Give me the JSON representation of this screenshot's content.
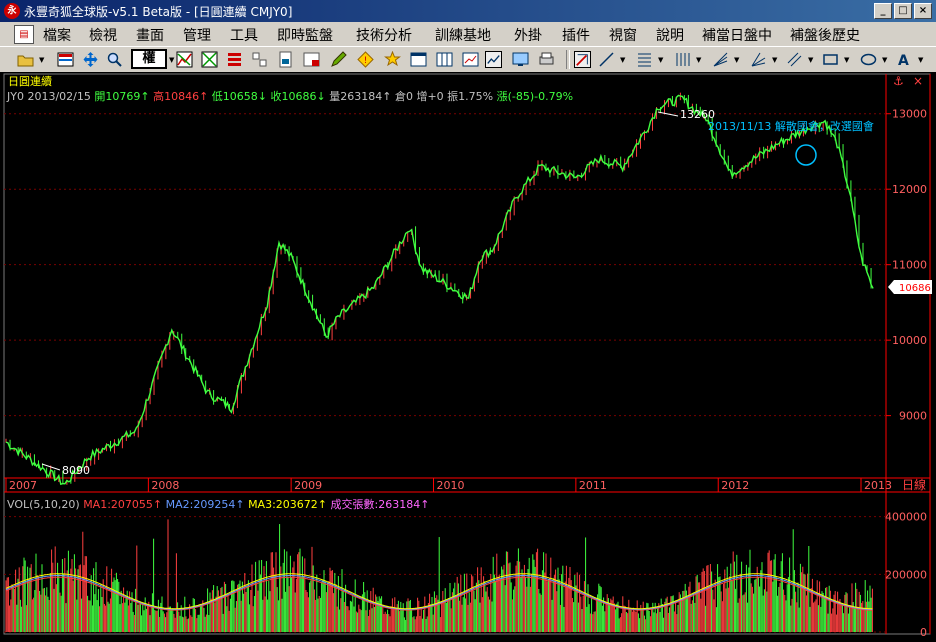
{
  "window": {
    "title": "永豐奇狐全球版-v5.1 Beta版 - [日圓連續 CMJY0]",
    "app_icon": "fox-logo-icon",
    "buttons": [
      "_",
      "□",
      "×"
    ]
  },
  "menu": {
    "items": [
      "檔案",
      "檢視",
      "畫面",
      "管理",
      "工具",
      "即時監盤",
      "技術分析",
      "訓練基地",
      "外掛",
      "插件",
      "視窗",
      "說明",
      "補當日盤中",
      "補盤後歷史"
    ]
  },
  "toolbar": {
    "quan_label": "權"
  },
  "chart": {
    "panel_title": "日圓連續",
    "info": {
      "symbol_date": "JY0 2013/02/15",
      "open": "開10769↑",
      "high": "高10846↑",
      "low": "低10658↓",
      "close": "收10686↓",
      "volume": "量263184↑",
      "oi": "倉0",
      "oi_change": "增+0",
      "amplitude": "振1.75%",
      "change": "漲(-85)-0.79%"
    },
    "annotation": "2013/11/13 解散國會，改選國會",
    "high_label": "13260",
    "low_label": "8090",
    "current_price_label": "10686",
    "x_axis_unit": "日線",
    "colors": {
      "up": "#ff4040",
      "down": "#40ff40",
      "grid": "#7a0000",
      "axis": "#ff0000",
      "annotation": "#00c0ff"
    }
  },
  "volume": {
    "labels": {
      "title": "VOL(5,10,20)",
      "ma1": "MA1:207055↑",
      "ma2": "MA2:209254↑",
      "ma3": "MA3:203672↑",
      "total": "成交張數:263184↑"
    }
  },
  "chart_data": [
    {
      "type": "line",
      "title": "日圓連續",
      "x": [
        "2007-01",
        "2007-06",
        "2007-08",
        "2007-12",
        "2008-03",
        "2008-06",
        "2008-08",
        "2008-11",
        "2008-12",
        "2009-01",
        "2009-04",
        "2009-05",
        "2009-08",
        "2009-11",
        "2009-12",
        "2010-04",
        "2010-05",
        "2010-06",
        "2010-08",
        "2010-10",
        "2011-01",
        "2011-03",
        "2011-05",
        "2011-07",
        "2011-08",
        "2011-10",
        "2011-11",
        "2011-12",
        "2012-02",
        "2012-04",
        "2012-06",
        "2012-09",
        "2012-10",
        "2012-11",
        "2012-12",
        "2013-01",
        "2013-02"
      ],
      "series": [
        {
          "values": [
            8650,
            8090,
            8450,
            8800,
            10150,
            9300,
            9100,
            10500,
            11300,
            11100,
            10050,
            10300,
            10700,
            11500,
            10950,
            10550,
            11100,
            11200,
            11900,
            12300,
            12150,
            12400,
            12300,
            12800,
            13100,
            13200,
            13050,
            12950,
            12200,
            12400,
            12600,
            12850,
            12900,
            12600,
            12000,
            11100,
            10686
          ]
        }
      ],
      "ylim": [
        8200,
        13500
      ],
      "y_ticks": [
        9000,
        10000,
        11000,
        12000,
        13000
      ],
      "x_tick_labels": [
        "2007",
        "2008",
        "2009",
        "2010",
        "2011",
        "2012",
        "2013"
      ],
      "xlabel": "日線",
      "grid": true,
      "annotations": [
        "13260",
        "8090",
        "2013/11/13 解散國會，改選國會",
        "10686"
      ]
    },
    {
      "type": "bar",
      "title": "VOL(5,10,20)",
      "y_ticks": [
        0,
        200000,
        400000
      ],
      "ylim": [
        0,
        430000
      ],
      "series": [
        {
          "name": "MA1",
          "values": [
            207055
          ]
        },
        {
          "name": "MA2",
          "values": [
            209254
          ]
        },
        {
          "name": "MA3",
          "values": [
            203672
          ]
        },
        {
          "name": "成交張數",
          "values": [
            263184
          ]
        }
      ],
      "grid": true
    }
  ]
}
